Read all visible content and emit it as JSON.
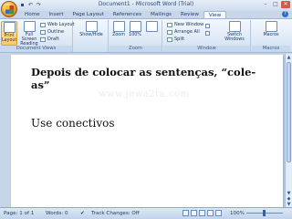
{
  "window": {
    "title": "Document1 - Microsoft Word (Trial)",
    "min": "–",
    "max": "□",
    "close": "✕"
  },
  "qat": {
    "save": "▪",
    "undo": "↶",
    "redo": "↷"
  },
  "tabs": [
    "Home",
    "Insert",
    "Page Layout",
    "References",
    "Mailings",
    "Review",
    "View"
  ],
  "active_tab": "View",
  "help": "?",
  "ribbon": {
    "document_views": {
      "label": "Document Views",
      "print_layout": "Print Layout",
      "full_screen": "Full Screen Reading",
      "web_layout": "Web Layout",
      "outline": "Outline",
      "draft": "Draft"
    },
    "show_hide": {
      "label": "Show/Hide"
    },
    "zoom": {
      "label": "Zoom",
      "zoom_btn": "Zoom",
      "percent": "100%"
    },
    "window": {
      "label": "Window",
      "new_window": "New Window",
      "arrange_all": "Arrange All",
      "split": "Split",
      "switch_windows": "Switch Windows"
    },
    "macros": {
      "label": "Macros",
      "macros_btn": "Macros"
    }
  },
  "document": {
    "heading": "Depois de colocar as sentenças, “cole-as”",
    "watermark": "www.jewa2ta.com",
    "paragraph": "Use conectivos"
  },
  "status": {
    "page": "Page: 1 of 1",
    "words": "Words: 0",
    "track_changes": "Track Changes: Off",
    "zoom": "100%"
  },
  "colors": {
    "ribbon_bg": "#dbe7f5",
    "accent": "#2c6fc0",
    "selected": "#ffc95a"
  }
}
